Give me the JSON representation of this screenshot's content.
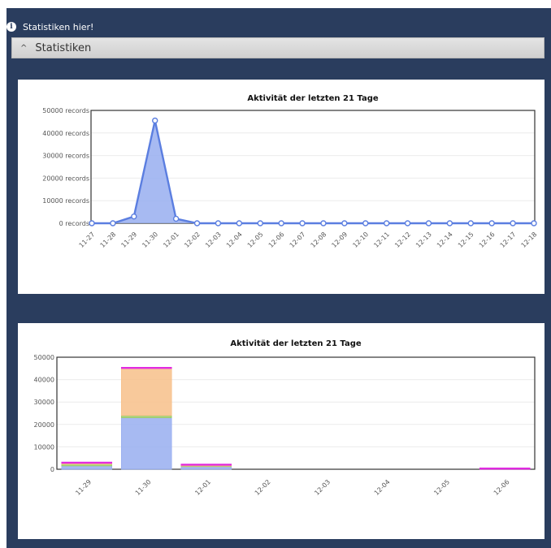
{
  "info": {
    "text": "Statistiken hier!",
    "icon": "info-icon"
  },
  "section": {
    "title": "Statistiken",
    "icon": "chevron-up-icon"
  },
  "colors": {
    "frame": "#2a3d5e",
    "line": "#5b7ee0",
    "fill": "#98aef0",
    "orange": "#f7c08a",
    "green": "#9ccc66",
    "magenta": "#e020e0"
  },
  "chart_data": [
    {
      "type": "area",
      "title": "Aktivität der letzten 21 Tage",
      "x": [
        "11-27",
        "11-28",
        "11-29",
        "11-30",
        "12-01",
        "12-02",
        "12-03",
        "12-04",
        "12-05",
        "12-06",
        "12-07",
        "12-08",
        "12-09",
        "12-10",
        "12-11",
        "12-12",
        "12-13",
        "12-14",
        "12-15",
        "12-16",
        "12-17",
        "12-18"
      ],
      "series": [
        {
          "values": [
            0,
            0,
            3000,
            45500,
            2000,
            0,
            0,
            0,
            0,
            0,
            0,
            0,
            0,
            0,
            0,
            0,
            0,
            0,
            0,
            0,
            0,
            0
          ]
        }
      ],
      "ylim": [
        0,
        50000
      ],
      "yticks": [
        "0  records",
        "10000  records",
        "20000  records",
        "30000  records",
        "40000  records",
        "50000  records"
      ],
      "grid": true
    },
    {
      "type": "bar",
      "stacked": true,
      "title": "Aktivität der letzten 21 Tage",
      "categories": [
        "11-29",
        "11-30",
        "12-01",
        "12-02",
        "12-03",
        "12-04",
        "12-05",
        "12-06"
      ],
      "series": [
        {
          "color": "#98aef0",
          "values": [
            1500,
            23000,
            1200,
            0,
            0,
            0,
            0,
            0
          ]
        },
        {
          "color": "#9ccc66",
          "values": [
            800,
            1000,
            500,
            0,
            0,
            0,
            0,
            0
          ]
        },
        {
          "color": "#f7c08a",
          "values": [
            500,
            21000,
            300,
            0,
            0,
            0,
            0,
            0
          ]
        },
        {
          "color": "#e020e0",
          "values": [
            400,
            500,
            300,
            0,
            0,
            0,
            0,
            600
          ]
        }
      ],
      "ylim": [
        0,
        50000
      ],
      "yticks": [
        "0",
        "10000",
        "20000",
        "30000",
        "40000",
        "50000"
      ],
      "grid": true
    }
  ]
}
